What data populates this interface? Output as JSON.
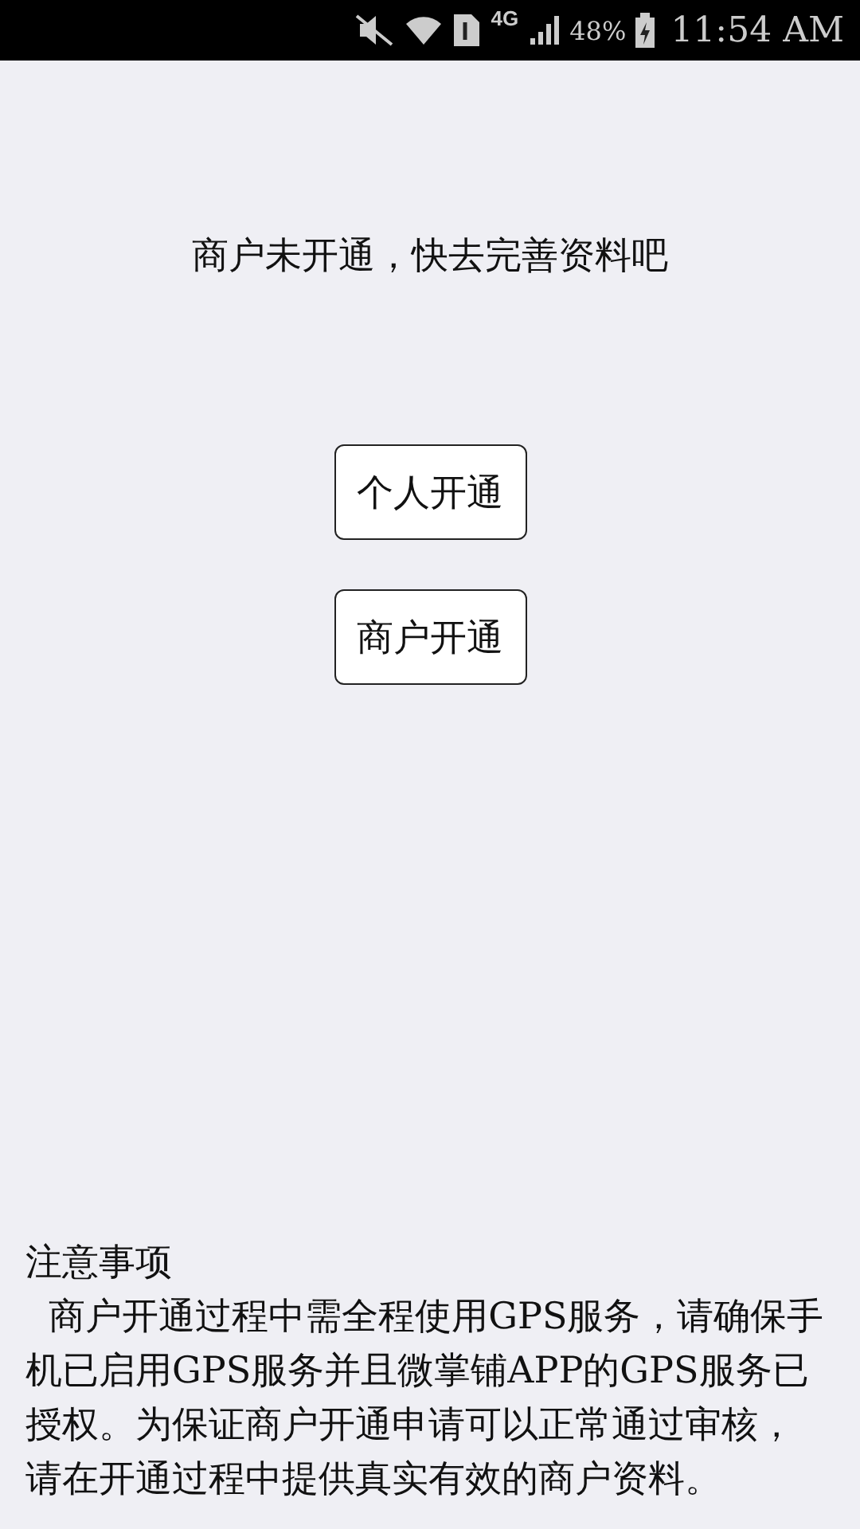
{
  "status_bar": {
    "network": "4G",
    "battery": "48%",
    "time": "11:54 AM"
  },
  "message": "商户未开通，快去完善资料吧",
  "buttons": [
    {
      "label": "个人开通"
    },
    {
      "label": "商户开通"
    }
  ],
  "notes": {
    "title": "注意事项",
    "text": "  商户开通过程中需全程使用GPS服务，请确保手机已启用GPS服务并且微掌铺APP的GPS服务已授权。为保证商户开通申请可以正常通过审核，请在开通过程中提供真实有效的商户资料。"
  }
}
